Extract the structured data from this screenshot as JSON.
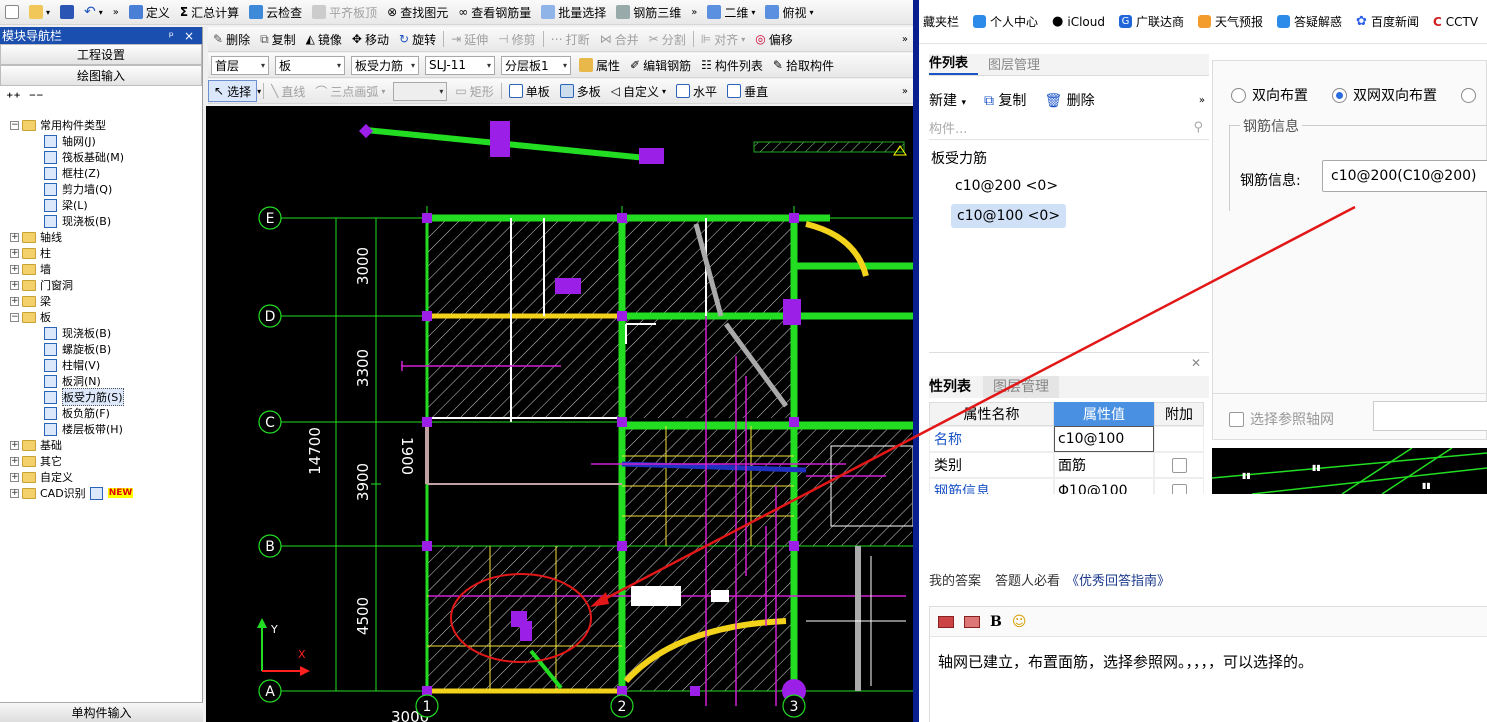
{
  "toolbar1": {
    "define": "定义",
    "sum": "汇总计算",
    "cloud_check": "云检查",
    "align_top": "平齐板顶",
    "find_element": "查找图元",
    "view_rebar": "查看钢筋量",
    "batch_select": "批量选择",
    "rebar_3d": "钢筋三维",
    "view_2d": "二维",
    "view_top": "俯视"
  },
  "toolbar2": {
    "delete": "删除",
    "copy": "复制",
    "mirror": "镜像",
    "move": "移动",
    "rotate": "旋转",
    "extend": "延伸",
    "trim": "修剪",
    "break": "打断",
    "merge": "合并",
    "split": "分割",
    "align": "对齐",
    "offset": "偏移"
  },
  "toolbar3": {
    "floor": "首层",
    "type": "板",
    "subtype": "板受力筋",
    "code": "SLJ-11",
    "layer": "分层板1",
    "props": "属性",
    "edit_rebar": "编辑钢筋",
    "element_list": "构件列表",
    "pick_element": "拾取构件"
  },
  "toolbar4": {
    "select": "选择",
    "line": "直线",
    "arc": "三点画弧",
    "rect": "矩形",
    "single_plate": "单板",
    "multi_plate": "多板",
    "custom": "自定义",
    "horizontal": "水平",
    "vertical": "垂直"
  },
  "nav": {
    "title": "模块导航栏",
    "pin": "ᵖ",
    "close": "×",
    "project_settings": "工程设置",
    "drawing_input": "绘图输入",
    "footer": "单构件输入",
    "tree": {
      "common": "常用构件类型",
      "c1": "轴网(J)",
      "c2": "筏板基础(M)",
      "c3": "框柱(Z)",
      "c4": "剪力墙(Q)",
      "c5": "梁(L)",
      "c6": "现浇板(B)",
      "axis": "轴线",
      "col": "柱",
      "wall": "墙",
      "door": "门窗洞",
      "beam": "梁",
      "slab": "板",
      "s1": "现浇板(B)",
      "s2": "螺旋板(B)",
      "s3": "柱帽(V)",
      "s4": "板洞(N)",
      "s5": "板受力筋(S)",
      "s6": "板负筋(F)",
      "s7": "楼层板带(H)",
      "foundation": "基础",
      "other": "其它",
      "customdef": "自定义",
      "cad": "CAD识别",
      "new_badge": "NEW"
    }
  },
  "canvas": {
    "axes_rows": [
      "E",
      "D",
      "C",
      "B",
      "A"
    ],
    "axes_cols": [
      "1",
      "2",
      "3"
    ],
    "dims": [
      "3000",
      "3300",
      "3900",
      "4500"
    ],
    "total": "14700",
    "sub_dim": "1900",
    "bottom_dim": "3000",
    "ucs_x": "X",
    "ucs_y": "Y"
  },
  "browser": {
    "b0": "藏夹栏",
    "b1": "个人中心",
    "b2": "iCloud",
    "b3": "广联达商",
    "b4": "天气预报",
    "b5": "答疑解惑",
    "b6": "百度新闻",
    "b7": "CCTV"
  },
  "panel": {
    "list_tab": "件列表",
    "layer_tab": "图层管理",
    "new": "新建",
    "copy": "复制",
    "delete": "删除",
    "search_placeholder": "构件...",
    "group": "板受力筋",
    "item1": "c10@200 <0>",
    "item2": "c10@100 <0>",
    "prop_tab": "性列表",
    "prop_layer_tab": "图层管理",
    "col_name": "属性名称",
    "col_value": "属性值",
    "col_extra": "附加",
    "r1_name": "名称",
    "r1_value": "c10@100",
    "r2_name": "类别",
    "r2_value": "面筋",
    "r3_name": "钢筋信息",
    "r3_value": "Φ10@100",
    "dir1": "双向布置",
    "dir2": "双网双向布置",
    "rebar_group": "钢筋信息",
    "rebar_label": "钢筋信息:",
    "rebar_value": "c10@200(C10@200)",
    "ref_axis": "选择参照轴网"
  },
  "answer": {
    "my_answer": "我的答案",
    "must_read": "答题人必看",
    "guide": "《优秀回答指南》",
    "bold": "B",
    "text": "轴网已建立，布置面筋，选择参照网。，，，，可以选择的。"
  }
}
